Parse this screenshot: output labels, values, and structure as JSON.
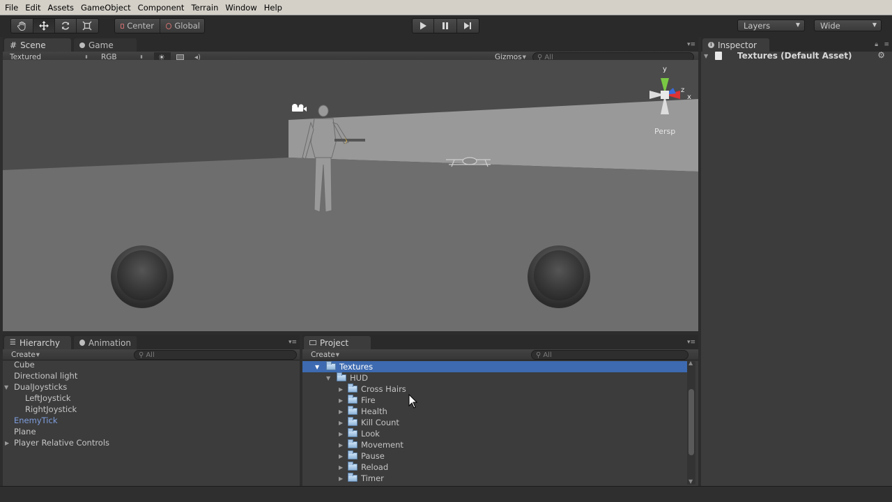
{
  "menu": [
    "File",
    "Edit",
    "Assets",
    "GameObject",
    "Component",
    "Terrain",
    "Window",
    "Help"
  ],
  "toolbar": {
    "transform_tools": [
      "hand-icon",
      "move-icon",
      "rotate-icon",
      "scale-icon"
    ],
    "pivot_label": "Center",
    "space_label": "Global",
    "play_icons": [
      "play-icon",
      "pause-icon",
      "step-icon"
    ],
    "layers_label": "Layers",
    "layout_label": "Wide"
  },
  "scene": {
    "tabs": [
      "Scene",
      "Game"
    ],
    "render_mode": "Textured",
    "color_mode": "RGB",
    "gizmos_label": "Gizmos",
    "search_placeholder": "All",
    "persp_label": "Persp",
    "axis_labels": {
      "y": "y",
      "x": "x",
      "z": "z"
    }
  },
  "inspector": {
    "tab": "Inspector",
    "title": "Textures (Default Asset)"
  },
  "hierarchy": {
    "tabs": [
      "Hierarchy",
      "Animation"
    ],
    "create_label": "Create",
    "search_placeholder": "All",
    "items": [
      {
        "label": "Cube"
      },
      {
        "label": "Directional light"
      },
      {
        "label": "DualJoysticks"
      },
      {
        "label": "LeftJoystick"
      },
      {
        "label": "RightJoystick"
      },
      {
        "label": "EnemyTick"
      },
      {
        "label": "Plane"
      },
      {
        "label": "Player Relative Controls"
      }
    ]
  },
  "project": {
    "tab": "Project",
    "create_label": "Create",
    "search_placeholder": "All",
    "selected_folder": "Textures",
    "parent_folder": "HUD",
    "folders": [
      "Cross Hairs",
      "Fire",
      "Health",
      "Kill Count",
      "Look",
      "Movement",
      "Pause",
      "Reload",
      "Timer"
    ]
  },
  "colors": {
    "selection": "#3d6ab0",
    "prefab_link": "#7f9fe0",
    "panel_bg": "#3c3c3c"
  }
}
